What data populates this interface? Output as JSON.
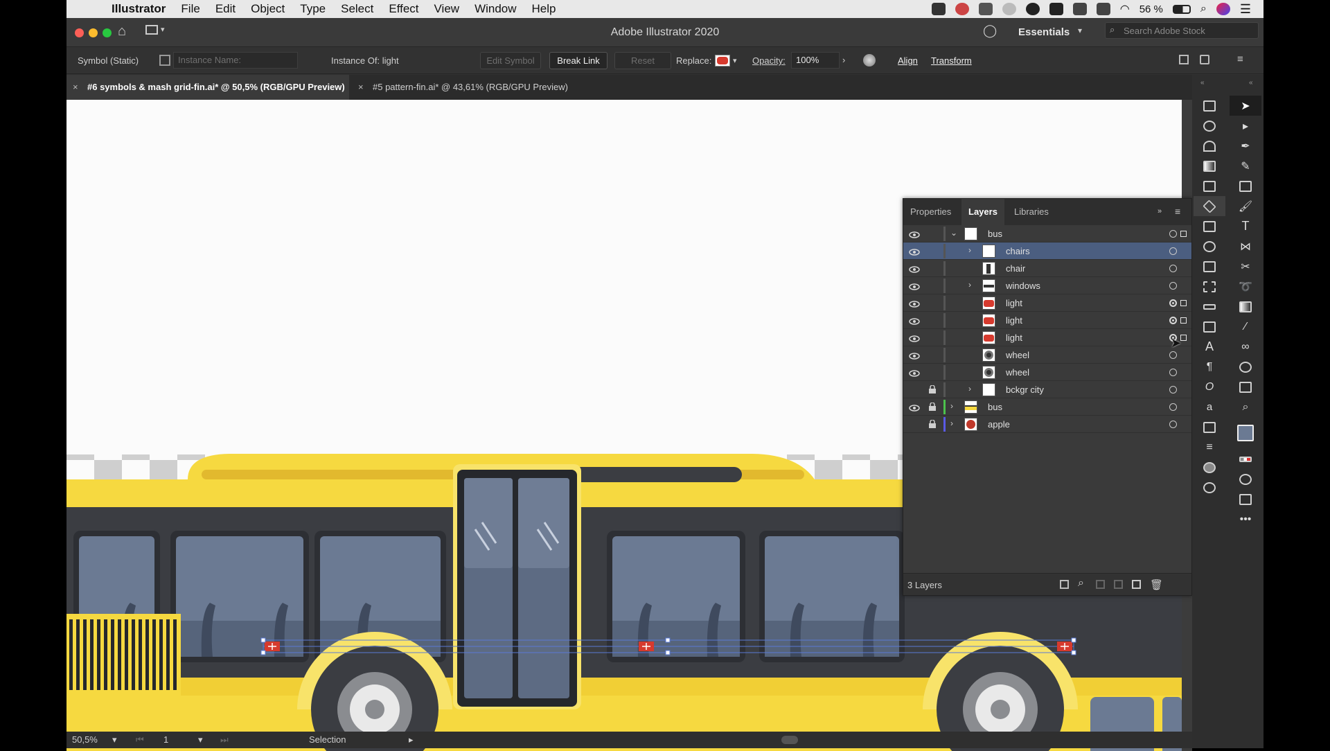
{
  "menubar": {
    "items": [
      "Illustrator",
      "File",
      "Edit",
      "Object",
      "Type",
      "Select",
      "Effect",
      "View",
      "Window",
      "Help"
    ],
    "battery": "56 %"
  },
  "window": {
    "title": "Adobe Illustrator 2020",
    "workspace": "Essentials",
    "search_placeholder": "Search Adobe Stock"
  },
  "controlbar": {
    "object_type": "Symbol (Static)",
    "instance_name_placeholder": "Instance Name:",
    "instance_of": "Instance Of: light",
    "edit_symbol": "Edit Symbol",
    "break_link": "Break Link",
    "reset": "Reset",
    "replace_label": "Replace:",
    "opacity_label": "Opacity:",
    "opacity_value": "100%",
    "align": "Align",
    "transform": "Transform"
  },
  "tabs": [
    {
      "label": "#6 symbols & mash grid-fin.ai* @ 50,5% (RGB/GPU Preview)",
      "active": true
    },
    {
      "label": "#5 pattern-fin.ai* @ 43,61% (RGB/GPU Preview)",
      "active": false
    }
  ],
  "layers_panel": {
    "tabs": [
      "Properties",
      "Layers",
      "Libraries"
    ],
    "active_tab": "Layers",
    "rows": [
      {
        "name": "bus",
        "depth": 0,
        "expanded": true,
        "visible": true,
        "locked": false,
        "thumb": "white",
        "selected_art": true
      },
      {
        "name": "chairs",
        "depth": 1,
        "expandable": true,
        "visible": true,
        "selected": true,
        "thumb": "white"
      },
      {
        "name": "chair",
        "depth": 1,
        "visible": true,
        "thumb": "chair"
      },
      {
        "name": "windows",
        "depth": 1,
        "expandable": true,
        "visible": true,
        "thumb": "windows"
      },
      {
        "name": "light",
        "depth": 1,
        "visible": true,
        "thumb": "red",
        "targeted": true
      },
      {
        "name": "light",
        "depth": 1,
        "visible": true,
        "thumb": "red",
        "targeted": true
      },
      {
        "name": "light",
        "depth": 1,
        "visible": true,
        "thumb": "red",
        "targeted": true
      },
      {
        "name": "wheel",
        "depth": 1,
        "visible": true,
        "thumb": "wheel"
      },
      {
        "name": "wheel",
        "depth": 1,
        "visible": true,
        "thumb": "wheel"
      },
      {
        "name": "bckgr city",
        "depth": 1,
        "expandable": true,
        "visible": false,
        "locked": true,
        "thumb": "white"
      },
      {
        "name": "bus",
        "depth": 0,
        "expandable": true,
        "visible": true,
        "locked": true,
        "thumb": "bus",
        "layer_color": "#4cc24c"
      },
      {
        "name": "apple",
        "depth": 0,
        "expandable": true,
        "visible": false,
        "locked": true,
        "thumb": "apple",
        "layer_color": "#5a5ae6"
      }
    ],
    "footer_count": "3 Layers"
  },
  "statusbar": {
    "zoom": "50,5%",
    "artboard": "1",
    "tool": "Selection"
  },
  "colors": {
    "bus_yellow": "#f6d940",
    "bus_dark": "#3b3d42",
    "window_blue": "#6b7a93",
    "selection_blue": "#4b5e80",
    "light_red": "#d63a2e"
  }
}
